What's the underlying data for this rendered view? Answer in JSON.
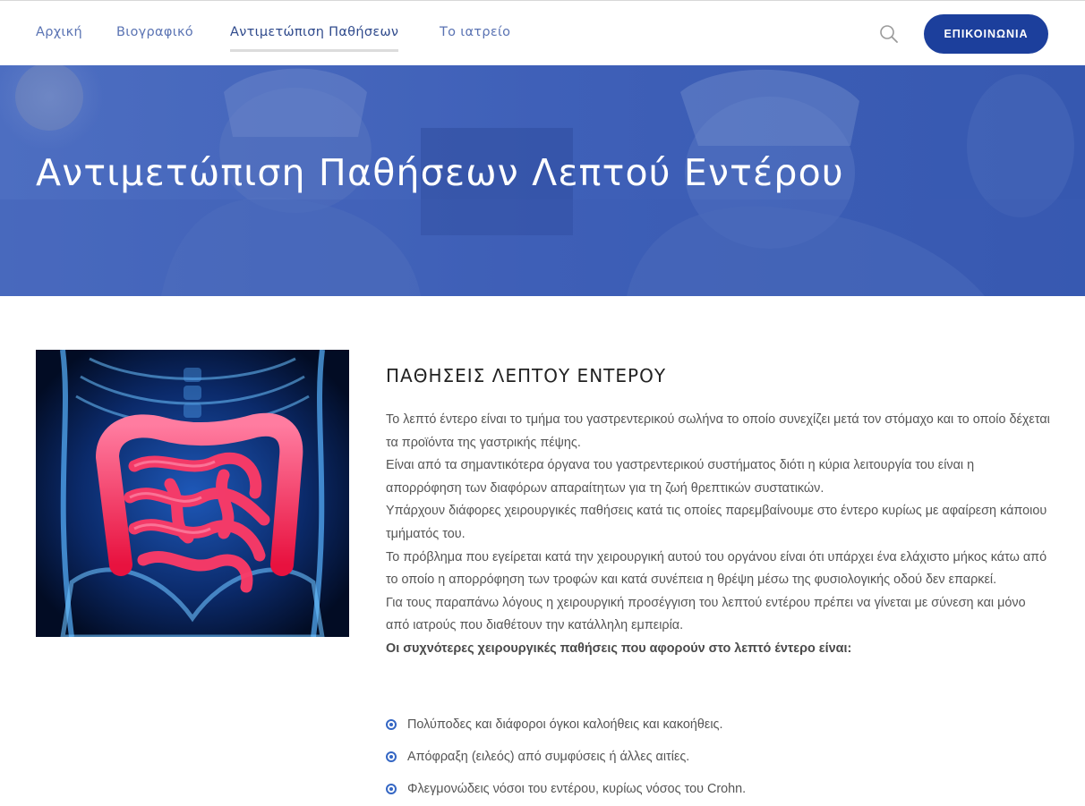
{
  "nav": {
    "items": [
      {
        "label": "Αρχική"
      },
      {
        "label": "Βιογραφικό"
      },
      {
        "label": "Αντιμετώπιση Παθήσεων",
        "active": true
      },
      {
        "label": "Το ιατρείο"
      }
    ],
    "contact_label": "ΕΠΙΚΟΙΝΩΝΙΑ",
    "search_icon": "search-icon",
    "accent_color": "#1c3f9c"
  },
  "hero": {
    "title": "Αντιμετώπιση Παθήσεων Λεπτού Εντέρου"
  },
  "content": {
    "section_title": "ΠΑΘΗΣΕΙΣ ΛΕΠΤΟΥ ΕΝΤΕΡΟΥ",
    "paragraphs": [
      "Το λεπτό έντερο είναι το τμήμα του γαστρεντερικού σωλήνα το οποίο συνεχίζει μετά τον στόμαχο και το οποίο δέχεται τα προϊόντα της γαστρικής πέψης.",
      "Είναι από τα σημαντικότερα όργανα του γαστρεντερικού συστήματος διότι η κύρια λειτουργία του είναι η απορρόφηση των διαφόρων απαραίτητων για τη ζωή θρεπτικών συστατικών.",
      "Υπάρχουν διάφορες χειρουργικές παθήσεις κατά τις οποίες παρεμβαίνουμε στο έντερο κυρίως με αφαίρεση κάποιου τμήματός του.",
      "Το πρόβλημα που εγείρεται κατά την χειρουργική αυτού του οργάνου είναι ότι υπάρχει ένα ελάχιστο μήκος κάτω από το οποίο η απορρόφηση των τροφών και κατά συνέπεια η θρέψη μέσω της φυσιολογικής οδού δεν επαρκεί.",
      "Για τους παραπάνω λόγους η χειρουργική προσέγγιση του λεπτού εντέρου πρέπει να γίνεται με σύνεση και μόνο από ιατρούς που διαθέτουν την κατάλληλη εμπειρία."
    ],
    "list_intro": "Οι συχνότερες χειρουργικές παθήσεις που αφορούν στο λεπτό έντερο είναι:",
    "conditions": [
      "Πολύποδες και διάφοροι όγκοι καλοήθεις και κακοήθεις.",
      "Απόφραξη (ειλεός) από συμφύσεις ή άλλες αιτίες.",
      "Φλεγμονώδεις νόσοι του εντέρου, κυρίως νόσος του Crohn."
    ]
  }
}
